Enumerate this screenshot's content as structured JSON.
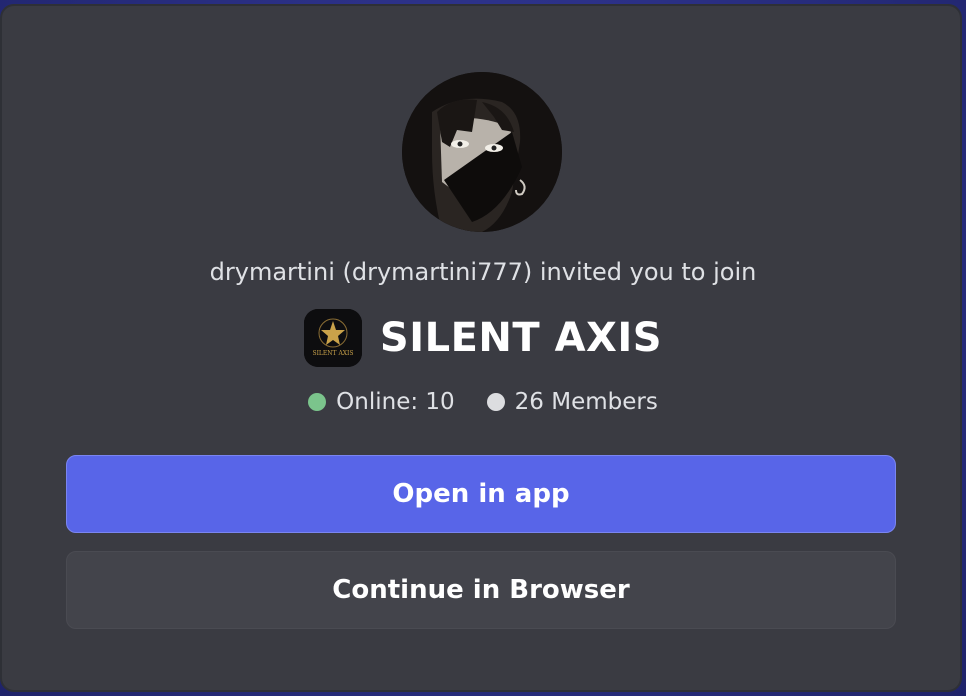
{
  "invite": {
    "inviter_text": "drymartini (drymartini777) invited you to join",
    "server_name": "SILENT AXIS",
    "server_icon_text": "SILENT AXIS",
    "online_label": "Online: 10",
    "members_label": "26 Members"
  },
  "buttons": {
    "open_app": "Open in app",
    "continue_browser": "Continue in Browser"
  },
  "colors": {
    "modal_bg": "#3a3b42",
    "primary_button": "#5865e8",
    "secondary_button": "#43444b",
    "online_dot": "#7bc48c",
    "members_dot": "#dcdde0",
    "backdrop": "#2a2f8a"
  },
  "icons": {
    "avatar": "inviter-avatar",
    "server_icon": "server-icon",
    "online_indicator": "online-dot-icon",
    "members_indicator": "members-dot-icon"
  }
}
